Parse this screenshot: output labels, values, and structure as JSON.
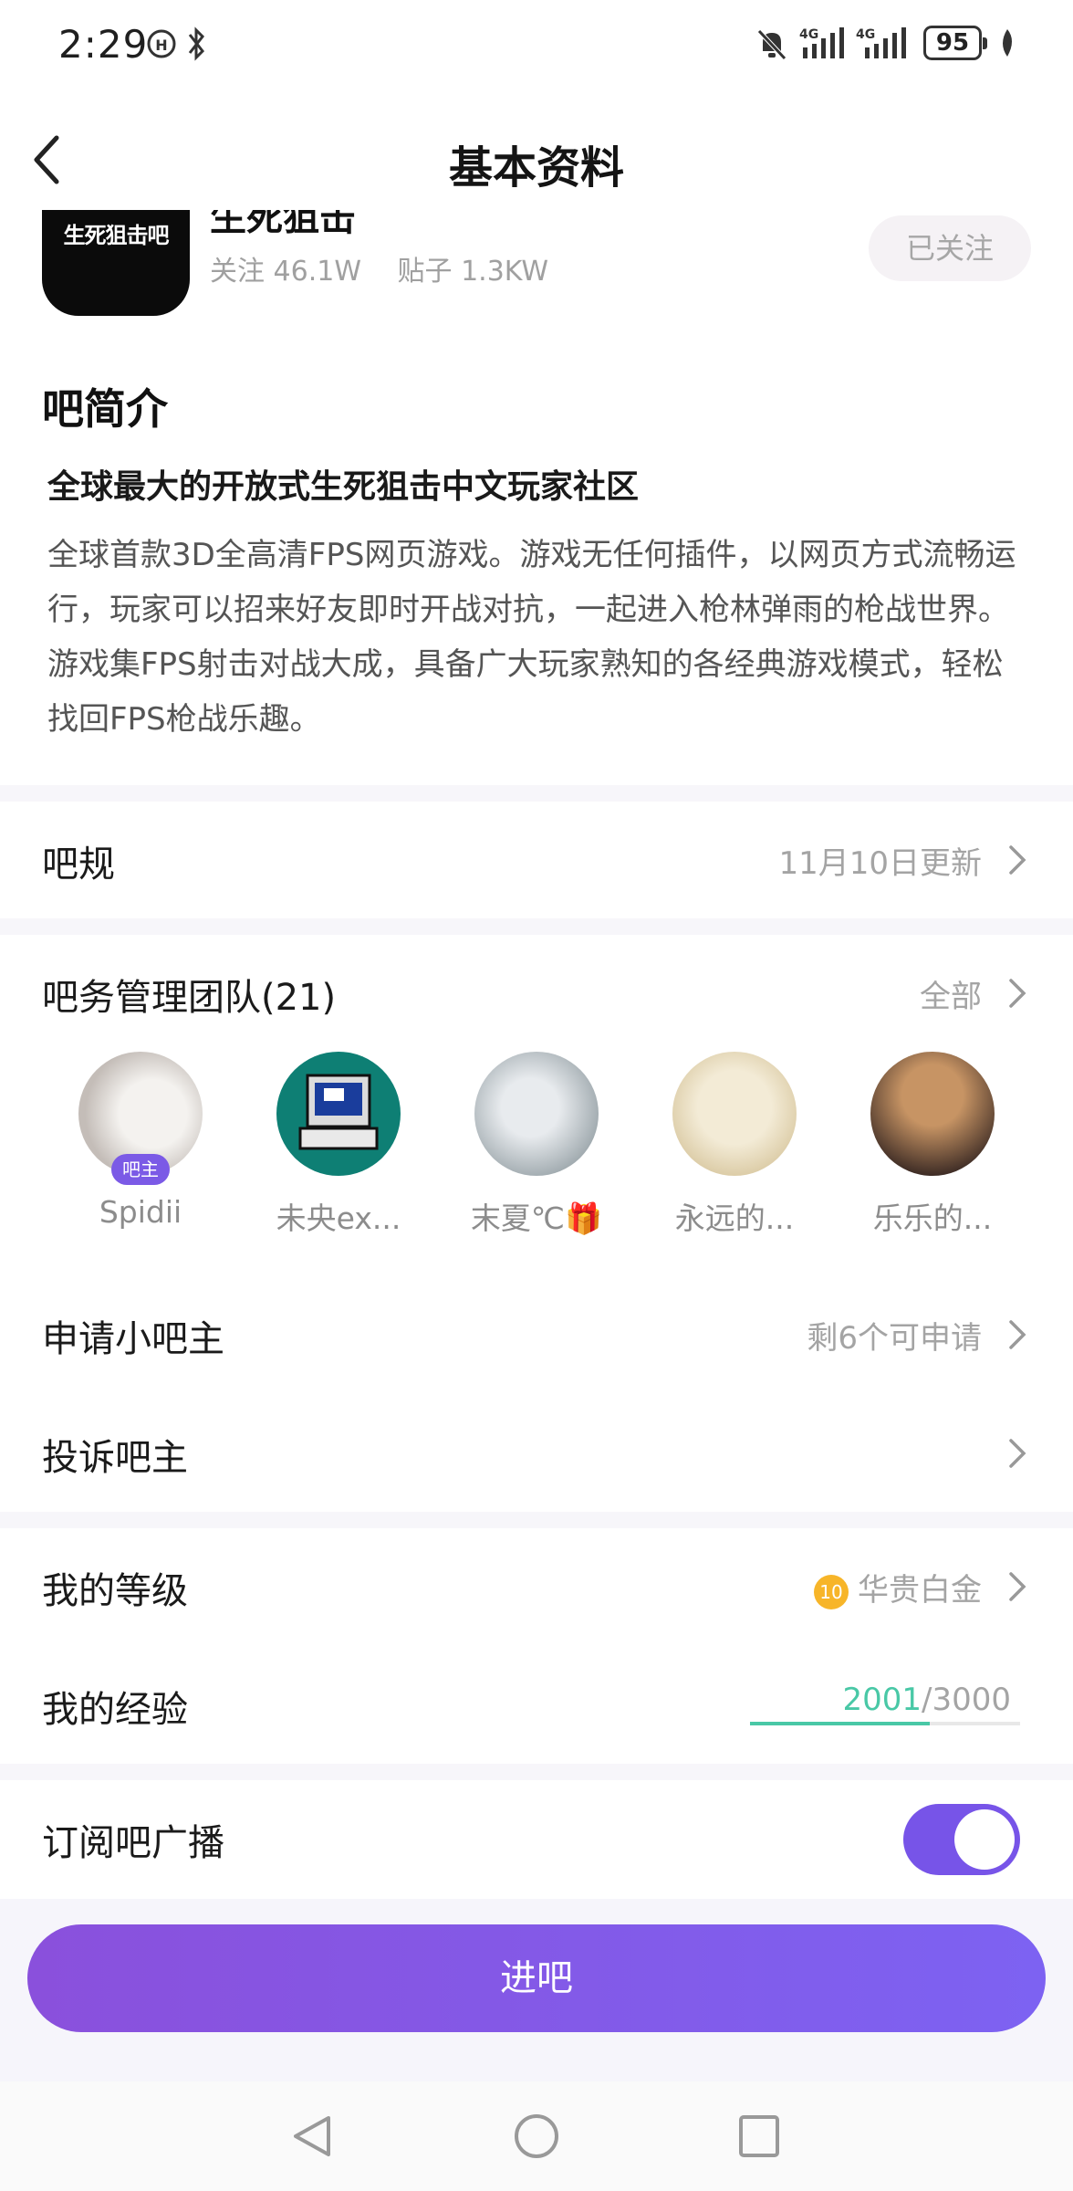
{
  "status_bar": {
    "time": "2:29",
    "network1": "4G",
    "network2": "4G",
    "battery": "95"
  },
  "header": {
    "title": "基本资料"
  },
  "forum": {
    "logo_text": "生死狙击吧",
    "name": "生死狙击",
    "followers": "关注 46.1W",
    "posts": "贴子 1.3KW",
    "follow_label": "已关注"
  },
  "intro": {
    "heading": "吧简介",
    "subtitle": "全球最大的开放式生死狙击中文玩家社区",
    "body": "全球首款3D全高清FPS网页游戏。游戏无任何插件，以网页方式流畅运行，玩家可以招来好友即时开战对抗，一起进入枪林弹雨的枪战世界。游戏集FPS射击对战大成，具备广大玩家熟知的各经典游戏模式，轻松找回FPS枪战乐趣。"
  },
  "rules": {
    "label": "吧规",
    "value": "11月10日更新"
  },
  "admin_team": {
    "label": "吧务管理团队(21)",
    "all_label": "全部",
    "members": [
      {
        "name": "Spidii",
        "badge": "吧主",
        "color": "#c9c4c0"
      },
      {
        "name": "未央ex...",
        "color": "#0e7f74"
      },
      {
        "name": "末夏℃🎁",
        "color": "#b7bfc4"
      },
      {
        "name": "永远的...",
        "color": "#e6d9b7"
      },
      {
        "name": "乐乐的...",
        "color": "#5a3b2e"
      }
    ]
  },
  "apply_admin": {
    "label": "申请小吧主",
    "value": "剩6个可申请"
  },
  "report_admin": {
    "label": "投诉吧主"
  },
  "level": {
    "label": "我的等级",
    "badge_num": "10",
    "value": "华贵白金"
  },
  "experience": {
    "label": "我的经验",
    "current": "2001",
    "total": "/3000",
    "fraction": 0.667
  },
  "subscribe": {
    "label": "订阅吧广播",
    "enabled": true
  },
  "enter_button": {
    "label": "进吧"
  }
}
